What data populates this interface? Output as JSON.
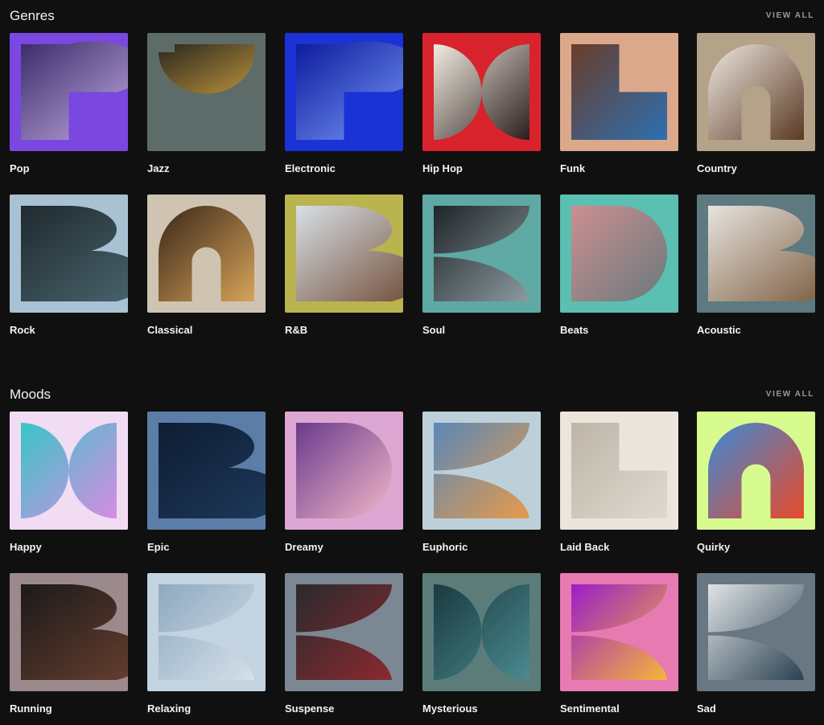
{
  "genres": {
    "title": "Genres",
    "view_all": "VIEW ALL",
    "items": [
      {
        "label": "Pop",
        "bg": "#7a47e0",
        "shape": "P",
        "c1": "#3b2a6a",
        "c2": "#c9b4e8"
      },
      {
        "label": "Jazz",
        "bg": "#5d6c68",
        "shape": "J",
        "c1": "#2a2620",
        "c2": "#b8913a"
      },
      {
        "label": "Electronic",
        "bg": "#1a32d6",
        "shape": "E",
        "c1": "#0b1a9c",
        "c2": "#7fa0ff"
      },
      {
        "label": "Hip Hop",
        "bg": "#d8232c",
        "shape": "H",
        "c1": "#f2ece2",
        "c2": "#2a1e1c"
      },
      {
        "label": "Funk",
        "bg": "#dba88c",
        "shape": "F",
        "c1": "#6a3d2a",
        "c2": "#2d6fb0"
      },
      {
        "label": "Country",
        "bg": "#b4a388",
        "shape": "C",
        "c1": "#efe8e0",
        "c2": "#5a3a24"
      },
      {
        "label": "Rock",
        "bg": "#a8c2d3",
        "shape": "R",
        "c1": "#1f2a2e",
        "c2": "#4b6670"
      },
      {
        "label": "Classical",
        "bg": "#cfc4b1",
        "shape": "C2",
        "c1": "#3a2618",
        "c2": "#d7a35a"
      },
      {
        "label": "R&B",
        "bg": "#b9b44e",
        "shape": "B",
        "c1": "#d8dfe6",
        "c2": "#6f4a34"
      },
      {
        "label": "Soul",
        "bg": "#5fa9a5",
        "shape": "S",
        "c1": "#1e2528",
        "c2": "#8d9aa0"
      },
      {
        "label": "Beats",
        "bg": "#5bbfb1",
        "shape": "Bt",
        "c1": "#cc8f92",
        "c2": "#6a7a7c"
      },
      {
        "label": "Acoustic",
        "bg": "#5d7a80",
        "shape": "A",
        "c1": "#e7e3df",
        "c2": "#7a5a3c"
      }
    ]
  },
  "moods": {
    "title": "Moods",
    "view_all": "VIEW ALL",
    "items": [
      {
        "label": "Happy",
        "bg": "#f1dcf4",
        "shape": "X",
        "c1": "#38c6c7",
        "c2": "#d88be3"
      },
      {
        "label": "Epic",
        "bg": "#5b7ea8",
        "shape": "Ep",
        "c1": "#0e1d33",
        "c2": "#1e3a5c"
      },
      {
        "label": "Dreamy",
        "bg": "#dda7d3",
        "shape": "D",
        "c1": "#6a3a8c",
        "c2": "#f2b8c8"
      },
      {
        "label": "Euphoric",
        "bg": "#bdd0da",
        "shape": "Eu",
        "c1": "#5a88b8",
        "c2": "#e89a4a"
      },
      {
        "label": "Laid Back",
        "bg": "#ece5dc",
        "shape": "L",
        "c1": "#bdb5a8",
        "c2": "#e0d9cf"
      },
      {
        "label": "Quirky",
        "bg": "#d8fb90",
        "shape": "Q",
        "c1": "#3a8ad8",
        "c2": "#e84a2a"
      },
      {
        "label": "Running",
        "bg": "#9c898b",
        "shape": "Ru",
        "c1": "#1c1a1a",
        "c2": "#6a4030"
      },
      {
        "label": "Relaxing",
        "bg": "#c3d3df",
        "shape": "Rl",
        "c1": "#8ea9c0",
        "c2": "#d5e0ea"
      },
      {
        "label": "Suspense",
        "bg": "#7b8792",
        "shape": "Su",
        "c1": "#2a2a2e",
        "c2": "#8a2a2e"
      },
      {
        "label": "Mysterious",
        "bg": "#5c7c7a",
        "shape": "M",
        "c1": "#1a3a40",
        "c2": "#4a8a90"
      },
      {
        "label": "Sentimental",
        "bg": "#e87ab2",
        "shape": "Se",
        "c1": "#9a1ec8",
        "c2": "#f6b53a"
      },
      {
        "label": "Sad",
        "bg": "#687782",
        "shape": "Sd",
        "c1": "#dfe4e6",
        "c2": "#2a4050"
      }
    ]
  }
}
